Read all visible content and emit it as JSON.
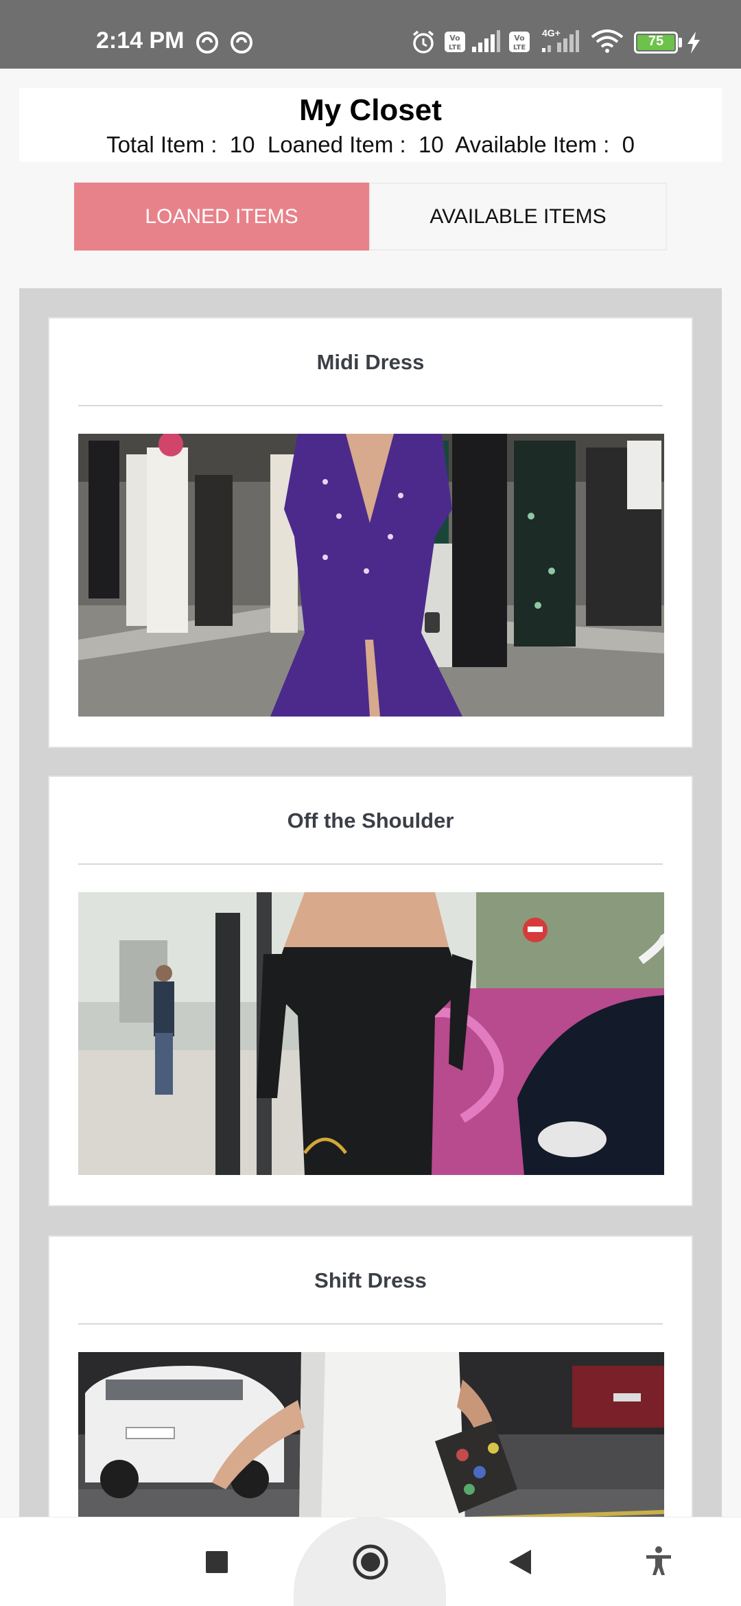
{
  "status_bar": {
    "time": "2:14 PM",
    "battery": "75",
    "network_label": "4G+"
  },
  "header": {
    "title": "My Closet",
    "total_label": "Total Item :  ",
    "total_value": "10",
    "loaned_label": "  Loaned Item :  ",
    "loaned_value": "10",
    "available_label": "  Available Item :  ",
    "available_value": "0"
  },
  "tabs": [
    {
      "label": "LOANED ITEMS",
      "active": true
    },
    {
      "label": "AVAILABLE ITEMS",
      "active": false
    }
  ],
  "items": [
    {
      "title": "Midi Dress",
      "image_icon": "purple-midi-dress-photo"
    },
    {
      "title": "Off the Shoulder",
      "image_icon": "black-off-shoulder-dress-photo"
    },
    {
      "title": "Shift Dress",
      "image_icon": "white-shift-dress-photo"
    }
  ],
  "nav": {
    "recents_icon": "square-icon",
    "home_icon": "circle-icon",
    "back_icon": "triangle-back-icon",
    "accessibility_icon": "accessibility-icon"
  },
  "colors": {
    "status_bar": "#6f6f6f",
    "active_tab": "#e8828a",
    "list_background": "#d3d3d3",
    "battery_fill": "#6cc24a"
  }
}
